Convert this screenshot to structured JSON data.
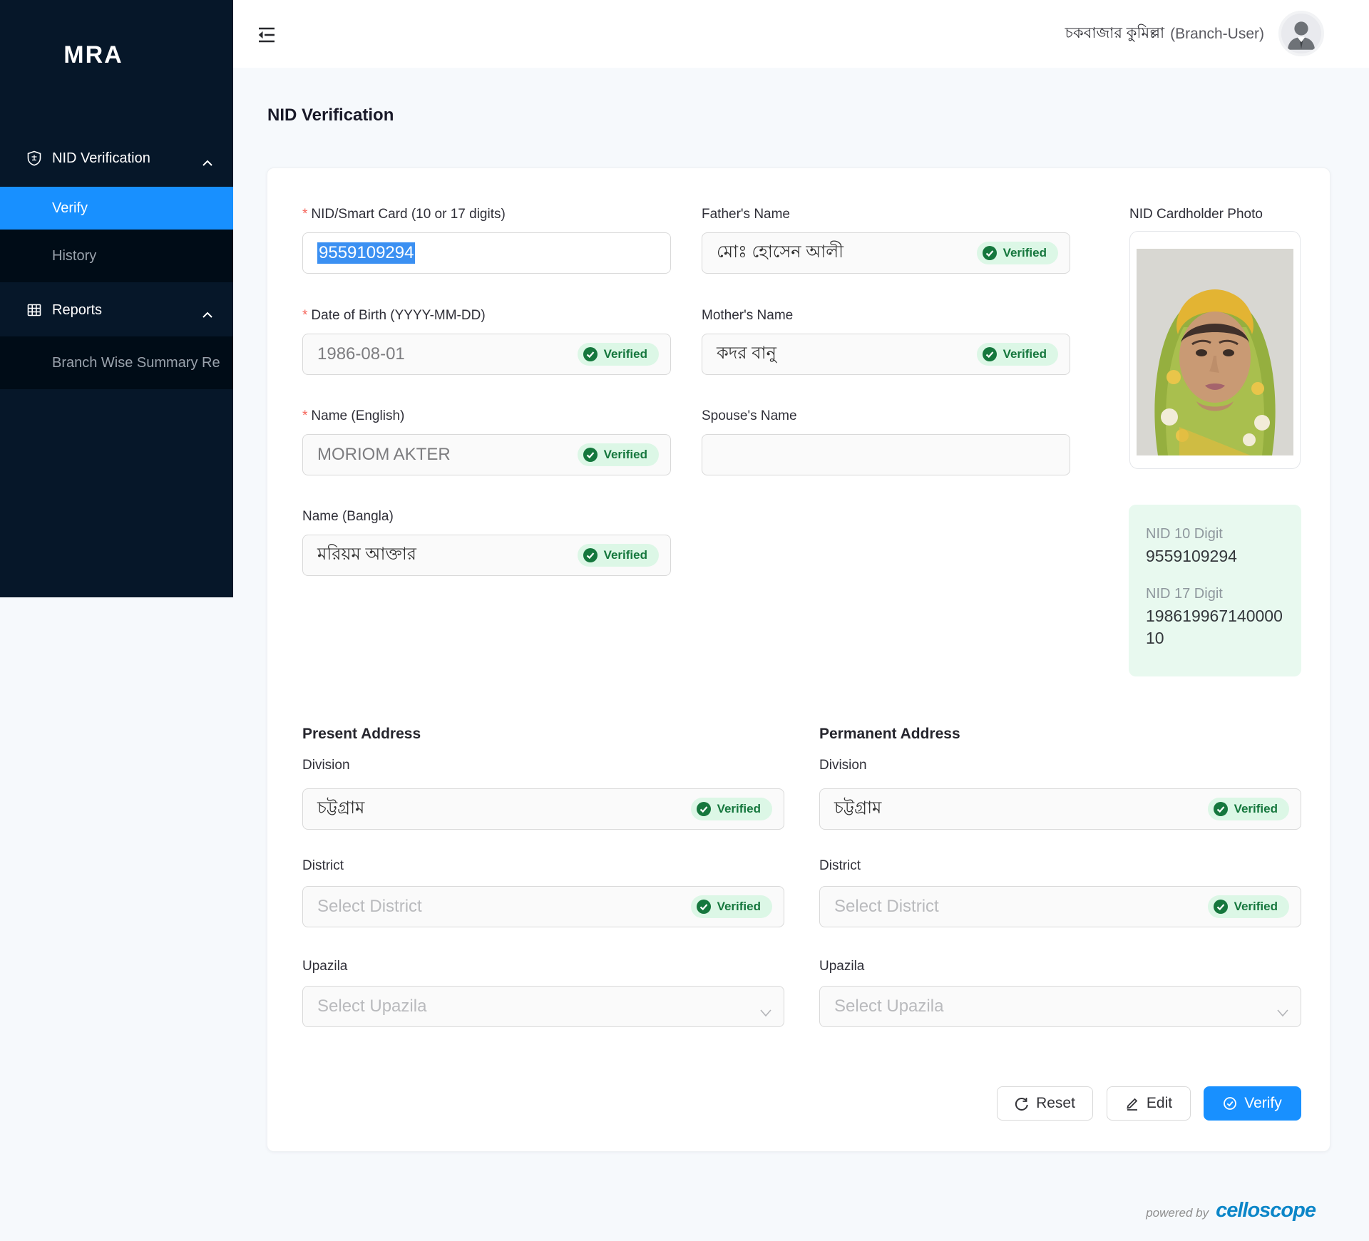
{
  "sidebar": {
    "logo": "MRA",
    "nid_menu_label": "NID Verification",
    "verify_label": "Verify",
    "history_label": "History",
    "reports_label": "Reports",
    "branch_report_label": "Branch Wise Summary Re",
    "colors": {
      "bg": "#061729",
      "submenu_bg": "#000c17",
      "active": "#1890ff"
    }
  },
  "header": {
    "user_name": "চকবাজার কুমিল্লা",
    "user_role": "(Branch-User)"
  },
  "page": {
    "title": "NID Verification"
  },
  "form": {
    "required_marker": "*",
    "verified_label": "Verified",
    "nid": {
      "label": "NID/Smart Card (10 or 17 digits)",
      "value": "9559109294"
    },
    "dob": {
      "label": "Date of Birth (YYYY-MM-DD)",
      "value": "1986-08-01"
    },
    "name_en": {
      "label": "Name (English)",
      "value": "MORIOM AKTER"
    },
    "name_bn": {
      "label": "Name (Bangla)",
      "value": "মরিয়ম আক্তার"
    },
    "father": {
      "label": "Father's Name",
      "value": "মোঃ হোসেন আলী"
    },
    "mother": {
      "label": "Mother's Name",
      "value": "কদর বানু"
    },
    "spouse": {
      "label": "Spouse's Name",
      "value": ""
    },
    "photo_label": "NID Cardholder Photo"
  },
  "nid_summary": {
    "nid10_label": "NID 10 Digit",
    "nid10_value": "9559109294",
    "nid17_label": "NID 17 Digit",
    "nid17_value": "19861996714000010",
    "box_bg": "#e8f9ef"
  },
  "address": {
    "present_title": "Present Address",
    "permanent_title": "Permanent Address",
    "division_label": "Division",
    "district_label": "District",
    "upazila_label": "Upazila",
    "present": {
      "division_value": "চট্টগ্রাম",
      "district_placeholder": "Select District",
      "upazila_placeholder": "Select Upazila"
    },
    "permanent": {
      "division_value": "চট্টগ্রাম",
      "district_placeholder": "Select District",
      "upazila_placeholder": "Select Upazila"
    }
  },
  "actions": {
    "reset": "Reset",
    "edit": "Edit",
    "verify": "Verify"
  },
  "footer": {
    "powered_by": "powered by",
    "brand": "celloscope",
    "brand_color": "#0c86c8"
  },
  "status_colors": {
    "badge_bg": "#dcf7e6",
    "badge_green": "#15773d",
    "primary": "#1890ff"
  }
}
